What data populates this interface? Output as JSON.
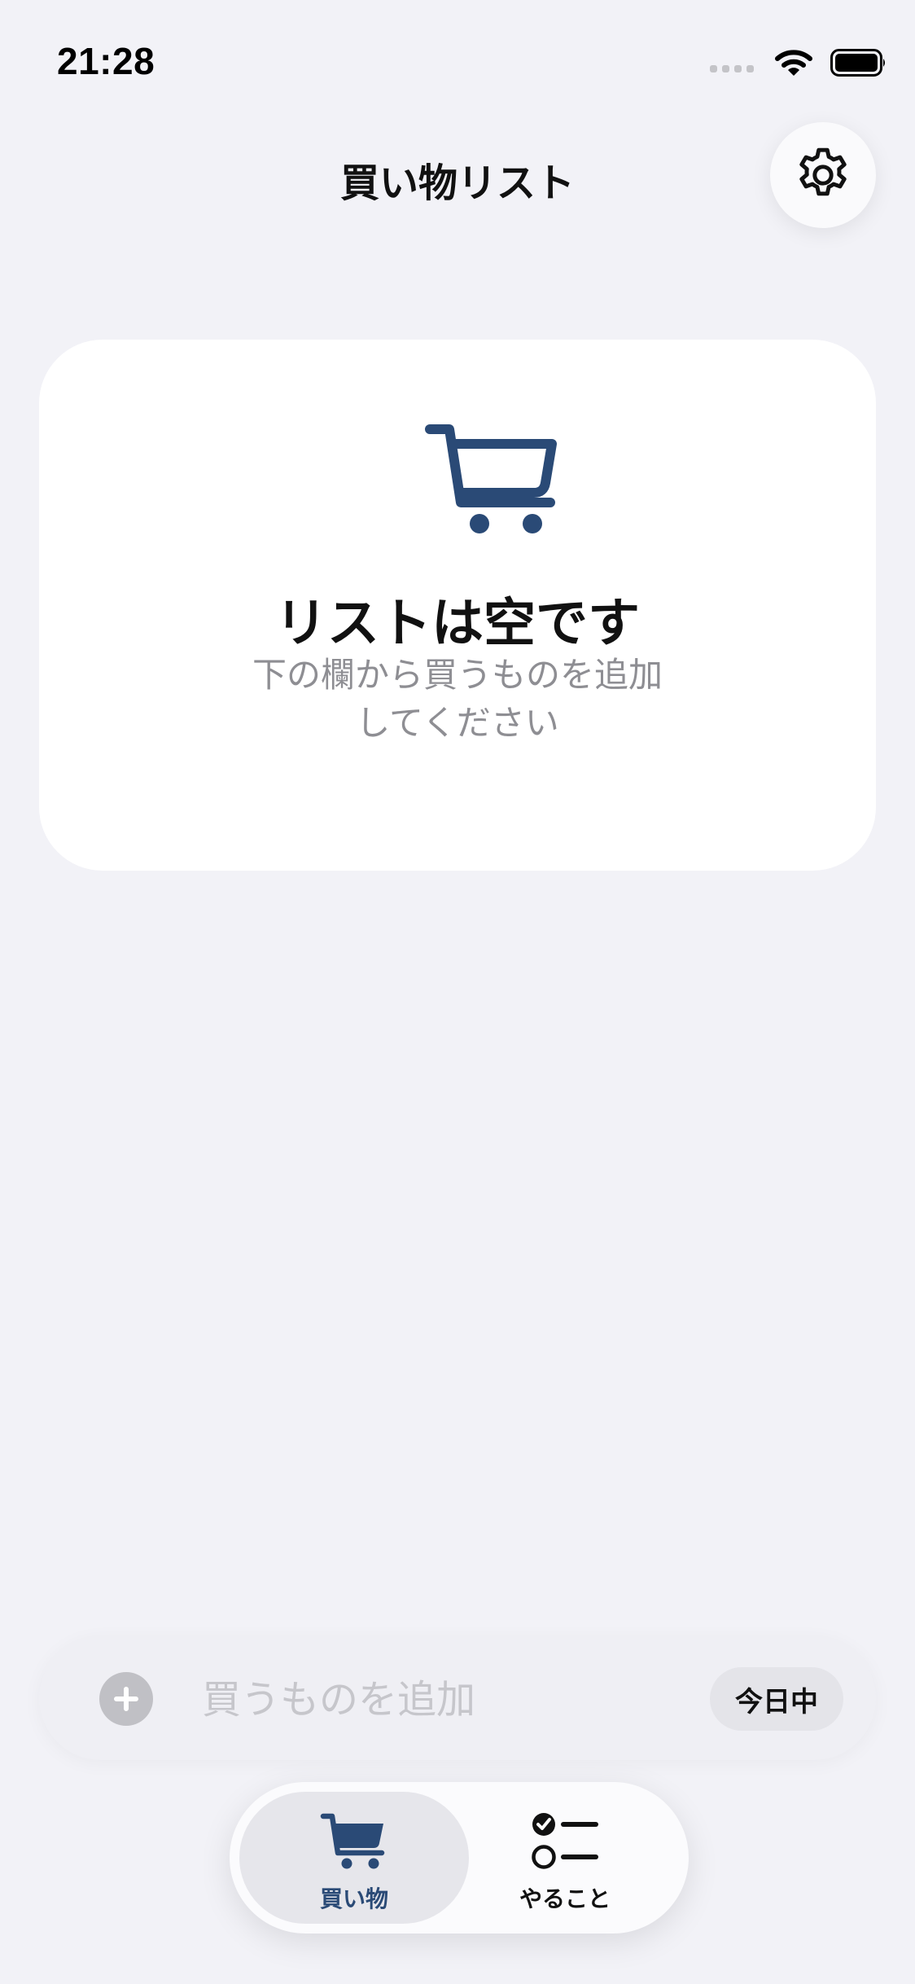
{
  "status_bar": {
    "time": "21:28",
    "icons": [
      "cellular-signal-icon",
      "wifi-icon",
      "battery-icon"
    ]
  },
  "header": {
    "title": "買い物リスト",
    "settings_icon": "gear-icon"
  },
  "empty_state": {
    "icon": "shopping-cart-icon",
    "title": "リストは空です",
    "subtitle": "下の欄から買うものを追加してください"
  },
  "add_bar": {
    "plus_icon": "plus-icon",
    "input_value": "",
    "placeholder": "買うものを追加",
    "due_chip_label": "今日中"
  },
  "tab_bar": {
    "tabs": [
      {
        "label": "買い物",
        "icon": "shopping-cart-icon",
        "selected": true
      },
      {
        "label": "やること",
        "icon": "checklist-icon",
        "selected": false
      }
    ]
  },
  "colors": {
    "accent": "#2a4a76",
    "background": "#f2f2f7",
    "card": "#ffffff",
    "secondary_text": "#8e8e93"
  }
}
